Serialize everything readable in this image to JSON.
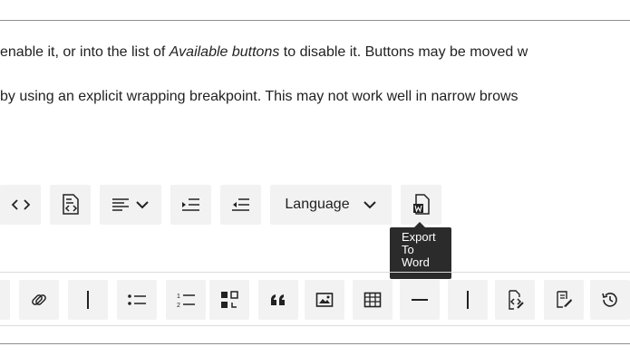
{
  "description": {
    "line1_pre": "enable it, or into the list of ",
    "line1_em": "Available buttons",
    "line1_post": " to disable it. Buttons may be moved w",
    "line2": "by using an explicit wrapping breakpoint. This may not work well in narrow brows"
  },
  "active_toolbar": {
    "buttons": [
      {
        "name": "code-icon"
      },
      {
        "name": "source-icon"
      },
      {
        "name": "align-dropdown"
      },
      {
        "name": "indent-icon"
      },
      {
        "name": "outdent-icon"
      },
      {
        "name": "language-dropdown",
        "label": "Language"
      },
      {
        "name": "export-to-word-icon"
      }
    ]
  },
  "tooltip": {
    "line1": "Export",
    "line2": "To",
    "line3": "Word"
  },
  "available_toolbar": {
    "buttons": [
      "link-icon",
      "divider-icon",
      "bulleted-list-icon",
      "numbered-list-icon",
      "media-embed-icon",
      "block-quote-icon",
      "image-icon",
      "table-icon",
      "horizontal-line-icon",
      "divider-icon",
      "source-editing-icon",
      "edit-icon",
      "history-icon"
    ]
  },
  "colors": {
    "button_bg": "#f2f2f2",
    "tooltip_bg": "#2b2b2b",
    "text": "#222222"
  }
}
